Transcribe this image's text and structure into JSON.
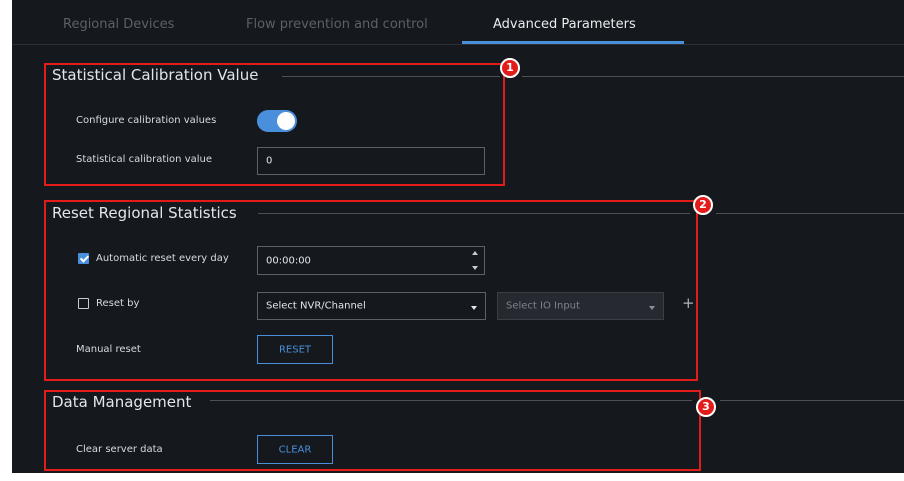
{
  "tabs": [
    {
      "label": "Regional Devices"
    },
    {
      "label": "Flow prevention and control"
    },
    {
      "label": "Advanced Parameters"
    }
  ],
  "calibration": {
    "title": "Statistical Calibration Value",
    "configure_label": "Configure calibration values",
    "configure_enabled": true,
    "value_label": "Statistical calibration value",
    "value": "0"
  },
  "reset": {
    "title": "Reset Regional Statistics",
    "auto_label": "Automatic reset every day",
    "auto_checked": true,
    "auto_time": "00:00:00",
    "reset_by_label": "Reset by",
    "reset_by_checked": false,
    "nvr_select": "Select NVR/Channel",
    "io_select": "Select IO Input",
    "add_icon": "plus-icon",
    "manual_label": "Manual reset",
    "reset_button": "RESET"
  },
  "data_management": {
    "title": "Data Management",
    "clear_label": "Clear server data",
    "clear_button": "CLEAR"
  },
  "annotations": [
    "1",
    "2",
    "3"
  ],
  "colors": {
    "background": "#15181c",
    "accent": "#4a8fdc",
    "highlight": "#e21b1b",
    "text": "#e2e6ea",
    "muted_text": "#5b6168"
  }
}
